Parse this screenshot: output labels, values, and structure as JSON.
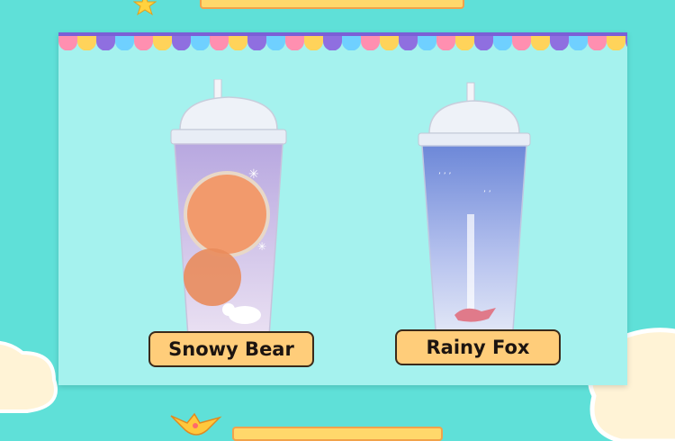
{
  "products": [
    {
      "label": "Snowy Bear",
      "icon": "polar-bear-cup-icon"
    },
    {
      "label": "Rainy Fox",
      "icon": "fox-cup-icon"
    }
  ],
  "colors": {
    "background": "#5fe0d8",
    "panel": "#a5f2ee",
    "button": "#ffcd7a",
    "button_border": "#3a2a1a",
    "accent": "#ffd86b"
  }
}
